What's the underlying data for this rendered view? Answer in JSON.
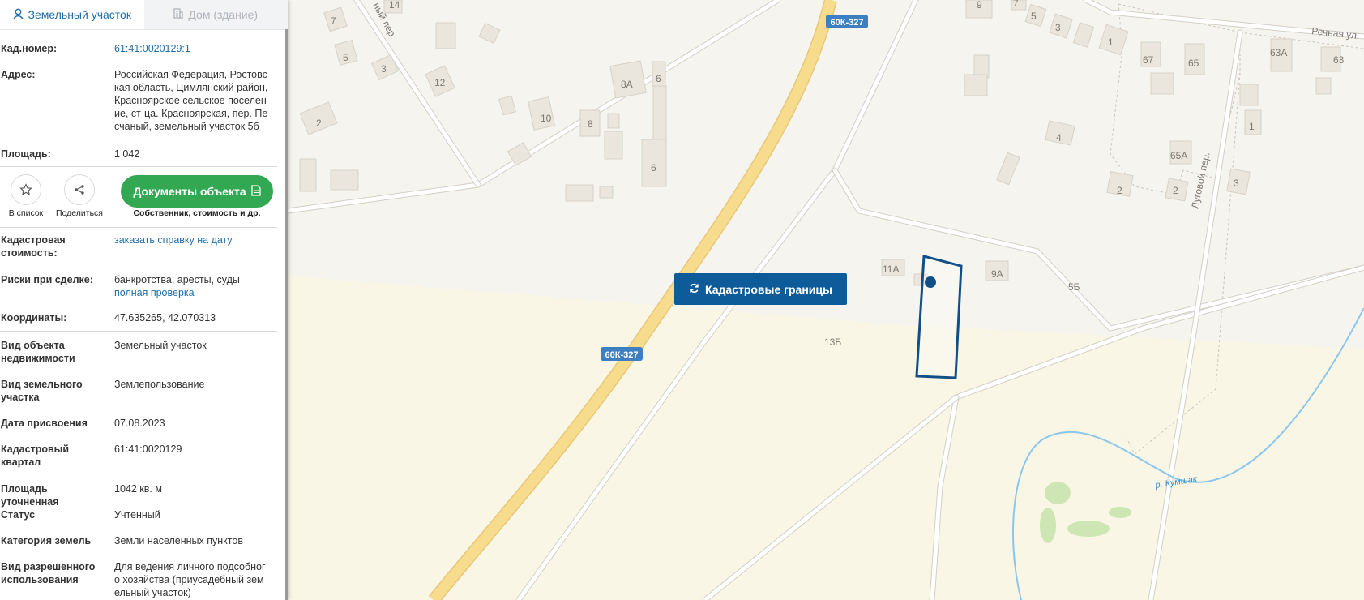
{
  "tabs": [
    {
      "label": "Земельный участок",
      "icon": "person-pin-icon",
      "active": true
    },
    {
      "label": "Дом (здание)",
      "icon": "building-icon",
      "active": false
    }
  ],
  "fields": {
    "cad_number": {
      "label": "Кад.номер:",
      "value": "61:41:0020129:1"
    },
    "address": {
      "label": "Адрес:",
      "lines": [
        "Российская Федерация, Ростовс",
        "кая область, Цимлянский район,",
        "Красноярское сельское поселен",
        "ие, ст-ца. Красноярская, пер. Пе",
        "счаный, земельный участок 5б"
      ]
    },
    "area": {
      "label": "Площадь:",
      "value": "1 042"
    },
    "cad_value": {
      "label_lines": [
        "Кадастровая",
        "стоимость:"
      ],
      "value": "заказать справку на дату"
    },
    "risks": {
      "label": "Риски при сделке:",
      "value": "банкротства, аресты, суды",
      "link": "полная проверка"
    },
    "coords": {
      "label": "Координаты:",
      "value": "47.635265, 42.070313"
    },
    "object_type": {
      "label_lines": [
        "Вид объекта",
        "недвижимости"
      ],
      "value": "Земельный участок"
    },
    "land_type": {
      "label_lines": [
        "Вид земельного",
        "участка"
      ],
      "value": "Землепользование"
    },
    "date": {
      "label": "Дата присвоения",
      "value": "07.08.2023"
    },
    "quarter": {
      "label_lines": [
        "Кадастровый",
        "квартал"
      ],
      "value": "61:41:0020129"
    },
    "area_exact": {
      "label": "Площадь уточненная",
      "value": "1042 кв. м"
    },
    "status": {
      "label": "Статус",
      "value": "Учтенный"
    },
    "category": {
      "label": "Категория земель",
      "value": "Земли населенных пунктов"
    },
    "permitted_use": {
      "label_lines": [
        "Вид разрешенного",
        "использования"
      ],
      "lines": [
        "Для ведения личного подсобног",
        "о хозяйства (приусадебный зем",
        "ельный участок)"
      ]
    }
  },
  "actions": {
    "add_list": {
      "label": "В список",
      "icon": "star-icon"
    },
    "share": {
      "label": "Поделиться",
      "icon": "share-icon"
    },
    "documents": {
      "label": "Документы объекта",
      "icon": "document-icon",
      "sub": "Собственник, стоимость и др."
    }
  },
  "map": {
    "cad_button": {
      "label": "Кадастровые границы",
      "icon": "refresh-icon"
    },
    "road_shields": [
      "60К-327",
      "60К-327"
    ],
    "street_labels": [
      "Речная ул.",
      "Луговой пер.",
      "р. Кумшак",
      "ный пер."
    ],
    "house_numbers": [
      "7",
      "14",
      "5",
      "3",
      "12",
      "2",
      "8А",
      "6",
      "10",
      "8",
      "6",
      "9",
      "7",
      "5",
      "3",
      "1",
      "67",
      "65",
      "63А",
      "63",
      "4",
      "1",
      "65А",
      "2",
      "2",
      "3",
      "11А",
      "9А",
      "5Б",
      "13Б"
    ]
  },
  "colors": {
    "accent": "#1f6eab",
    "green_button": "#32a852",
    "cad_button_bg": "#0d5b98",
    "parcel_outline": "#114f86",
    "highway": "#f8dc8e",
    "road_shield": "#3d7fc1",
    "river": "#8cc6ec"
  }
}
